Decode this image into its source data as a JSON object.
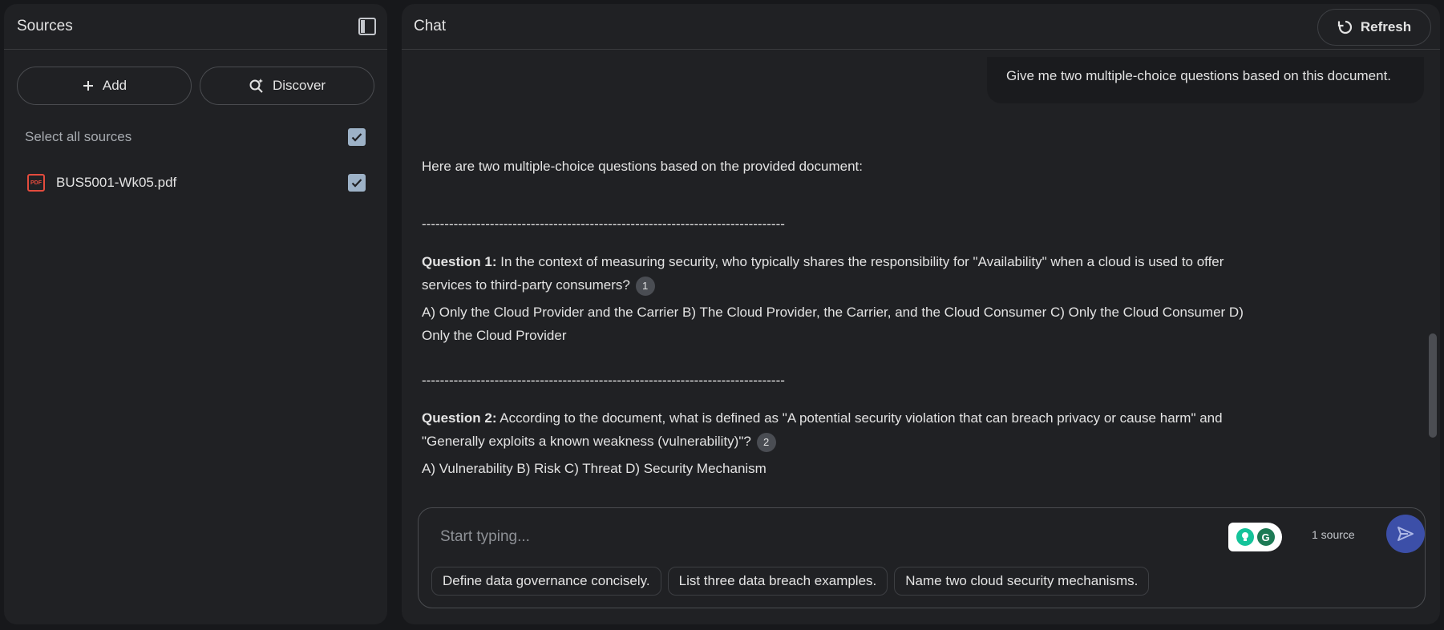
{
  "sources": {
    "title": "Sources",
    "add_label": "Add",
    "discover_label": "Discover",
    "select_all_label": "Select all sources",
    "items": [
      {
        "name": "BUS5001-Wk05.pdf",
        "type_badge": "PDF",
        "checked": true
      }
    ]
  },
  "chat": {
    "title": "Chat",
    "refresh_label": "Refresh",
    "user_message": "Give me two multiple-choice questions based on this document.",
    "response": {
      "intro": "Here are two multiple-choice questions based on the provided document:",
      "separator": "--------------------------------------------------------------------------------",
      "q1_label": "Question 1:",
      "q1_text": " In the context of measuring security, who typically shares the responsibility for \"Availability\" when a cloud is used to offer services to third-party consumers?",
      "q1_cite": "1",
      "q1_options": "A) Only the Cloud Provider and the Carrier B) The Cloud Provider, the Carrier, and the Cloud Consumer C) Only the Cloud Consumer D) Only the Cloud Provider",
      "q2_label": "Question 2:",
      "q2_text": " According to the document, what is defined as \"A potential security violation that can breach privacy or cause harm\" and \"Generally exploits a known weakness (vulnerability)\"?",
      "q2_cite": "2",
      "q2_options": "A) Vulnerability B) Risk C) Threat D) Security Mechanism"
    },
    "composer": {
      "placeholder": "Start typing...",
      "source_count": "1 source"
    },
    "suggestions": [
      "Define data governance concisely.",
      "List three data breach examples.",
      "Name two cloud security mechanisms."
    ]
  },
  "colors": {
    "accent": "#3c4fa8",
    "pdf_red": "#e34b3d",
    "checkbox": "#9db2c7"
  }
}
